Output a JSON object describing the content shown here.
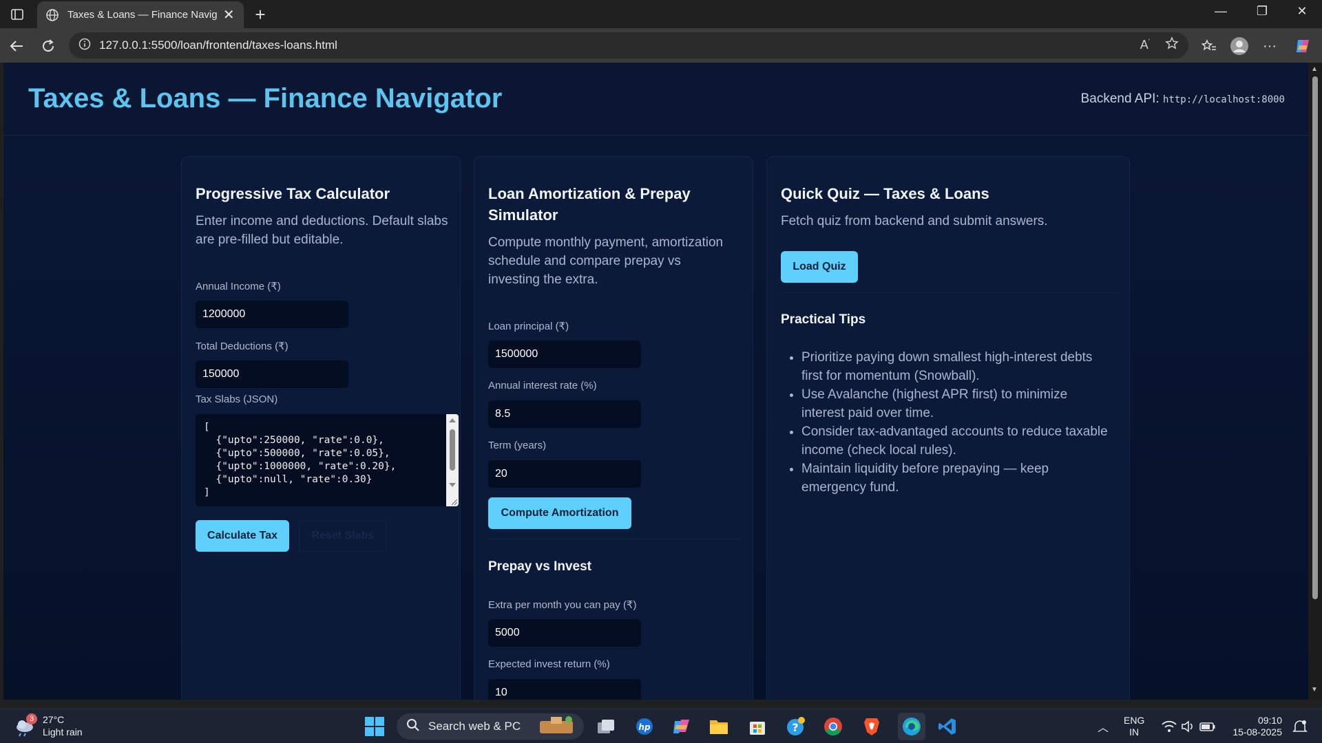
{
  "browser": {
    "tab_title": "Taxes & Loans — Finance Navigat",
    "url": "127.0.0.1:5500/loan/frontend/taxes-loans.html"
  },
  "page": {
    "title": "Taxes & Loans — Finance Navigator",
    "backend_label": "Backend API:",
    "backend_url": "http://localhost:8000"
  },
  "tax_card": {
    "heading": "Progressive Tax Calculator",
    "description": "Enter income and deductions. Default slabs are pre-filled but editable.",
    "income_label": "Annual Income (₹)",
    "income_value": "1200000",
    "deductions_label": "Total Deductions (₹)",
    "deductions_value": "150000",
    "slabs_label": "Tax Slabs (JSON)",
    "slabs_value": "[\n  {\"upto\":250000, \"rate\":0.0},\n  {\"upto\":500000, \"rate\":0.05},\n  {\"upto\":1000000, \"rate\":0.20},\n  {\"upto\":null, \"rate\":0.30}\n]",
    "calculate_label": "Calculate Tax",
    "reset_label": "Reset Slabs"
  },
  "loan_card": {
    "heading": "Loan Amortization & Prepay Simulator",
    "description": "Compute monthly payment, amortization schedule and compare prepay vs investing the extra.",
    "principal_label": "Loan principal (₹)",
    "principal_value": "1500000",
    "rate_label": "Annual interest rate (%)",
    "rate_value": "8.5",
    "term_label": "Term (years)",
    "term_value": "20",
    "compute_label": "Compute Amortization",
    "prepay_heading": "Prepay vs Invest",
    "extra_label": "Extra per month you can pay (₹)",
    "extra_value": "5000",
    "return_label": "Expected invest return (%)",
    "return_value": "10"
  },
  "quiz_card": {
    "heading": "Quick Quiz — Taxes & Loans",
    "description": "Fetch quiz from backend and submit answers.",
    "load_label": "Load Quiz",
    "tips_heading": "Practical Tips",
    "tips": [
      "Prioritize paying down smallest high-interest debts first for momentum (Snowball).",
      "Use Avalanche (highest APR first) to minimize interest paid over time.",
      "Consider tax-advantaged accounts to reduce taxable income (check local rules).",
      "Maintain liquidity before prepaying — keep emergency fund."
    ]
  },
  "taskbar": {
    "weather_badge": "3",
    "temperature": "27°C",
    "condition": "Light rain",
    "search_placeholder": "Search web & PC",
    "lang_line1": "ENG",
    "lang_line2": "IN",
    "time": "09:10",
    "date": "15-08-2025"
  }
}
